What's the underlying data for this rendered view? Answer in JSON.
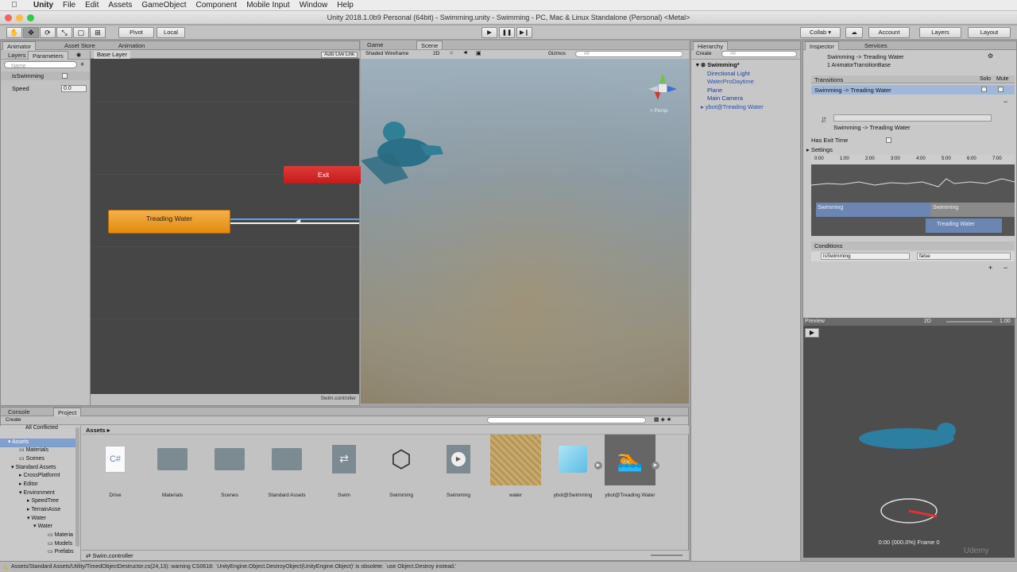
{
  "menubar": {
    "app": "Unity",
    "items": [
      "File",
      "Edit",
      "Assets",
      "GameObject",
      "Component",
      "Mobile Input",
      "Window",
      "Help"
    ]
  },
  "window": {
    "title": "Unity 2018.1.0b9 Personal (64bit) - Swimming.unity - Swimming - PC, Mac & Linux Standalone (Personal) <Metal>"
  },
  "toolbar": {
    "pivot": "Pivot",
    "local": "Local",
    "collab": "Collab ▾",
    "account": "Account",
    "layers": "Layers",
    "layout": "Layout"
  },
  "animator": {
    "tabs": [
      "Animator",
      "Asset Store",
      "Animation"
    ],
    "subtabs": [
      "Layers",
      "Parameters"
    ],
    "base_layer": "Base Layer",
    "auto_live_link": "Auto Live Link",
    "search_placeholder": "Name",
    "params": [
      {
        "name": "isSwimming",
        "type": "bool"
      },
      {
        "name": "Speed",
        "value": "0.0"
      }
    ],
    "nodes": {
      "exit": "Exit",
      "treading": "Treading Water"
    },
    "footer": "Swim.controller"
  },
  "scene": {
    "tabs": [
      "Game",
      "Scene"
    ],
    "shading": "Shaded Wireframe",
    "mode_2d": "2D",
    "gizmos": "Gizmos",
    "search": "All",
    "persp": "< Persp"
  },
  "hierarchy": {
    "tab": "Hierarchy",
    "create": "Create",
    "search": "All",
    "root": "Swimming*",
    "items": [
      "Directional Light",
      "WaterProDaytime",
      "Plane",
      "Main Camera",
      "ybot@Treading Water"
    ]
  },
  "inspector": {
    "tabs": [
      "Inspector",
      "Services"
    ],
    "title": "Swimming -> Treading Water",
    "subtitle": "1 AnimatorTransitionBase",
    "transitions_label": "Transitions",
    "solo": "Solo",
    "mute": "Mute",
    "transition_row": "Swimming -> Treading Water",
    "detail_title": "Swimming -> Treading Water",
    "has_exit_time": "Has Exit Time",
    "settings": "Settings",
    "timeline_ticks": [
      "0:00",
      "1:00",
      "2:00",
      "3:00",
      "4:00",
      "5:00",
      "6:00",
      "7:00"
    ],
    "bar_swimming_a": "Swimming",
    "bar_swimming_b": "Swimming",
    "bar_treading": "Treading Water",
    "conditions": "Conditions",
    "cond_param": "isSwimming",
    "cond_value": "false"
  },
  "preview": {
    "label": "Preview",
    "mode": "2D",
    "speed": "1.00",
    "frame": "0:00 (000.0%) Frame 0",
    "watermark": "Udemy"
  },
  "project": {
    "tabs": [
      "Console",
      "Project"
    ],
    "create": "Create",
    "tree": [
      "All Conflicted",
      "Assets",
      "Materials",
      "Scenes",
      "Standard Assets",
      "CrossPlatformI",
      "Editor",
      "Environment",
      "SpeedTree",
      "TerrainAsse",
      "Water",
      "Water",
      "Materia",
      "Models",
      "Prefabs"
    ],
    "breadcrumb": "Assets",
    "assets": [
      "Drive",
      "Materials",
      "Scenes",
      "Standard Assets",
      "Swim",
      "Swimming",
      "Swimming",
      "water",
      "ybot@Swimming",
      "ybot@Treading Water"
    ],
    "selected_file": "Swim.controller"
  },
  "status": {
    "message": "Assets/Standard Assets/Utility/TimedObjectDestructor.cs(24,13): warning CS0618: `UnityEngine.Object.DestroyObject(UnityEngine.Object)' is obsolete: `use Object.Destroy instead.'"
  }
}
